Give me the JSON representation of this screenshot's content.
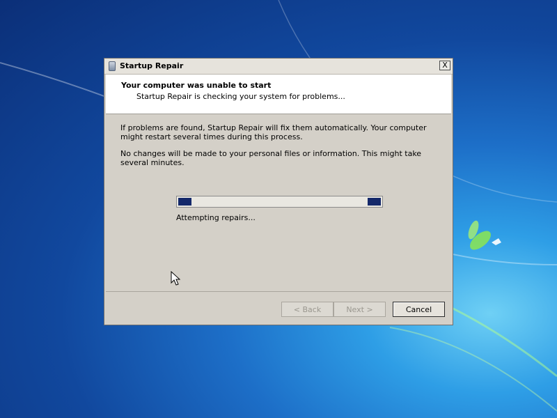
{
  "window": {
    "title": "Startup Repair",
    "close_label": "X"
  },
  "header": {
    "title": "Your computer was unable to start",
    "subtitle": "Startup Repair is checking your system for problems..."
  },
  "body": {
    "paragraph1": "If problems are found, Startup Repair will fix them automatically. Your computer might restart several times during this process.",
    "paragraph2": "No changes will be made to your personal files or information. This might take several minutes."
  },
  "progress": {
    "status_text": "Attempting repairs...",
    "style": "indeterminate",
    "color": "#14286a"
  },
  "buttons": {
    "back_label": "< Back",
    "next_label": "Next >",
    "cancel_label": "Cancel"
  },
  "icons": {
    "title_icon": "startup-repair-icon",
    "cursor": "mouse-pointer-icon"
  }
}
